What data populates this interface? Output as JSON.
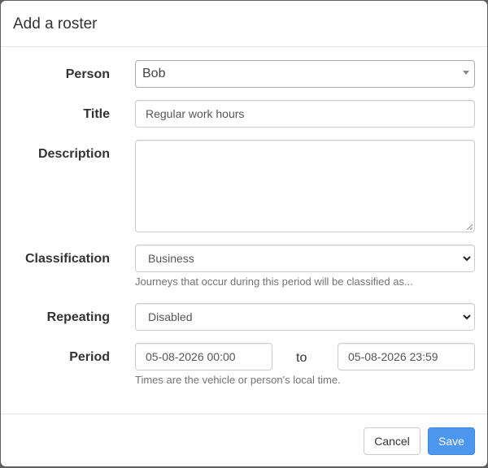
{
  "dialog": {
    "title": "Add a roster"
  },
  "form": {
    "person": {
      "label": "Person",
      "value": "Bob"
    },
    "title": {
      "label": "Title",
      "value": "Regular work hours"
    },
    "description": {
      "label": "Description",
      "value": ""
    },
    "classification": {
      "label": "Classification",
      "value": "Business",
      "help": "Journeys that occur during this period will be classified as..."
    },
    "repeating": {
      "label": "Repeating",
      "value": "Disabled"
    },
    "period": {
      "label": "Period",
      "start": "05-08-2026 00:00",
      "separator": "to",
      "end": "05-08-2026 23:59",
      "help": "Times are the vehicle or person's local time."
    }
  },
  "footer": {
    "cancel_label": "Cancel",
    "save_label": "Save"
  },
  "colors": {
    "primary": "#4d97ef",
    "overlay": "#5f5f5f"
  }
}
